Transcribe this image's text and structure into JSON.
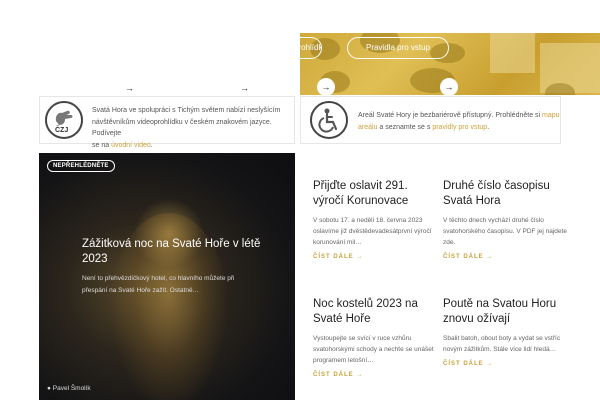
{
  "top_arrows": [
    "→",
    "→"
  ],
  "banner": {
    "left_pill_label": "prohlídky",
    "right_pill_label": "Pravidla pro vstup",
    "arrow": "→"
  },
  "info_sign": {
    "icon_caption": "ČZJ",
    "text_1": "Svatá Hora ve spolupráci s Tichým světem nabízí neslyšícím",
    "text_2": "návštěvníkům videoprohlídku v českém znakovém jazyce. Podívejte",
    "text_3_prefix": "se na ",
    "text_3_link": "úvodní video",
    "text_3_suffix": "."
  },
  "info_access": {
    "text_1_prefix": "Areál Svaté Hory je bezbariérově přístupný. Prohlédněte si ",
    "text_1_link": "mapu",
    "text_2_link": "areálu",
    "text_2_middle": " a seznamte se s ",
    "text_2_link2": "pravidly pro vstup",
    "text_2_suffix": "."
  },
  "feature": {
    "badge": "NEPŘEHLÉDNĚTE",
    "title": "Zážitková noc na Svaté Hoře v létě 2023",
    "excerpt": "Není to přehvězdičkový hotel, co hlavního můžete při přespání na Svaté Hoře zažít. Ostatně…",
    "author": "Pavel Šmolík"
  },
  "articles": [
    {
      "title": "Přijďte oslavit 291. výročí Korunovace",
      "excerpt": "V sobotu 17. a neděli 18. června 2023 oslavíme již dvěstědevadesátprvní výročí korunování mil…",
      "read_more": "ČÍST DÁLE →"
    },
    {
      "title": "Druhé číslo časopisu Svatá Hora",
      "excerpt": "V těchto dnech vychází druhé číslo svatohorského časopisu. V PDF jej najdete zde.",
      "read_more": "ČÍST DÁLE →"
    },
    {
      "title": "Noc kostelů 2023 na Svaté Hoře",
      "excerpt": "Vystoupejte se svící v ruce vzhůru svatohorskými schody a nechte se unášet programem letošní…",
      "read_more": "ČÍST DÁLE →"
    },
    {
      "title": "Poutě na Svatou Horu znovu ožívají",
      "excerpt": "Sbalit batoh, obout boty a vydat se vstříc novým zážitkům. Stále více lidí hledá…",
      "read_more": "ČÍST DÁLE →"
    }
  ],
  "colors": {
    "accent": "#c9a23a",
    "banner": "#d4b043",
    "dark": "#141416"
  }
}
